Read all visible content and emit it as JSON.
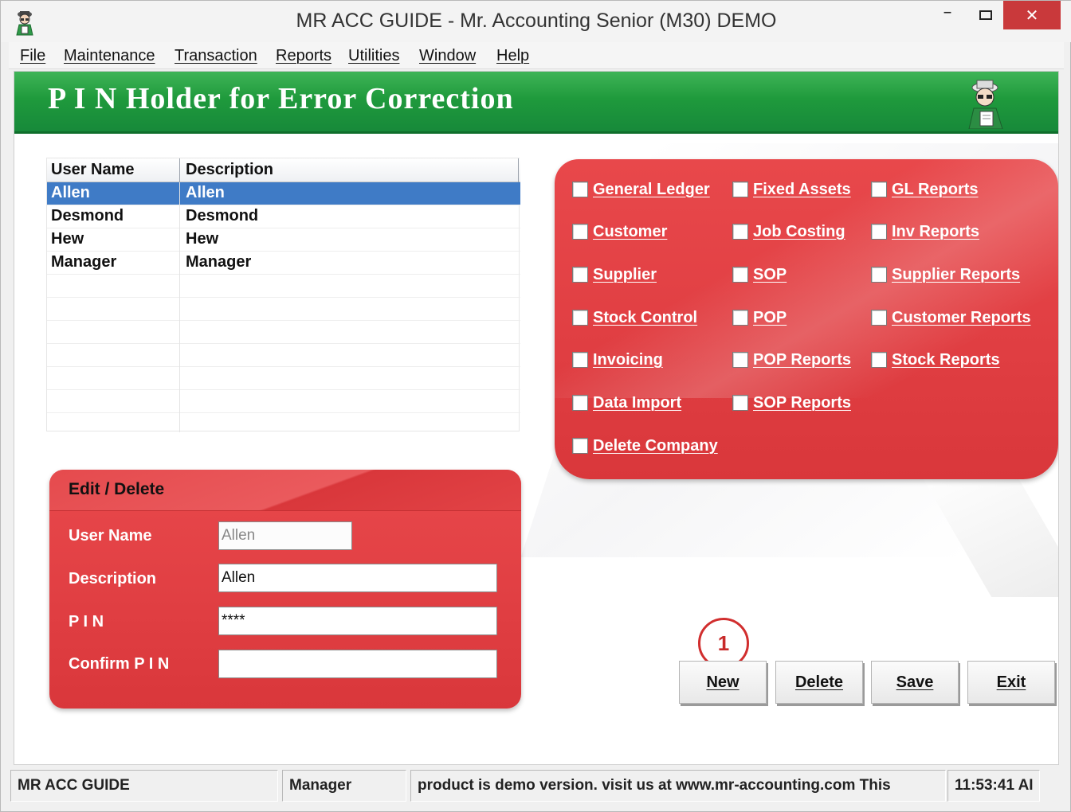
{
  "window": {
    "title": "MR ACC GUIDE - Mr. Accounting Senior (M30) DEMO",
    "close_glyph": "✕",
    "minimize_glyph": "–"
  },
  "menu": {
    "items": [
      {
        "label": "File"
      },
      {
        "label": "Maintenance"
      },
      {
        "label": "Transaction"
      },
      {
        "label": "Reports"
      },
      {
        "label": "Utilities"
      },
      {
        "label": "Window"
      },
      {
        "label": "Help"
      }
    ]
  },
  "banner": {
    "title": "P I N Holder for Error Correction"
  },
  "user_grid": {
    "columns": [
      "User Name",
      "Description"
    ],
    "rows": [
      {
        "user": "Allen",
        "description": "Allen",
        "selected": true
      },
      {
        "user": "Desmond",
        "description": "Desmond",
        "selected": false
      },
      {
        "user": "Hew",
        "description": "Hew",
        "selected": false
      },
      {
        "user": "Manager",
        "description": "Manager",
        "selected": false
      }
    ]
  },
  "modules": {
    "checkboxes": [
      {
        "label": "General Ledger",
        "checked": false
      },
      {
        "label": "Fixed Assets",
        "checked": false
      },
      {
        "label": "GL Reports",
        "checked": false
      },
      {
        "label": "Customer",
        "checked": false
      },
      {
        "label": "Job Costing",
        "checked": false
      },
      {
        "label": "Inv Reports",
        "checked": false
      },
      {
        "label": "Supplier",
        "checked": false
      },
      {
        "label": "SOP",
        "checked": false
      },
      {
        "label": "Supplier Reports",
        "checked": false
      },
      {
        "label": "Stock Control",
        "checked": false
      },
      {
        "label": "POP",
        "checked": false
      },
      {
        "label": "Customer Reports",
        "checked": false
      },
      {
        "label": "Invoicing",
        "checked": false
      },
      {
        "label": "POP Reports",
        "checked": false
      },
      {
        "label": "Stock Reports",
        "checked": false
      },
      {
        "label": "Data Import",
        "checked": false
      },
      {
        "label": "SOP Reports",
        "checked": false
      },
      {
        "label": "Delete Company",
        "checked": false
      }
    ]
  },
  "edit_panel": {
    "title": "Edit / Delete",
    "user_name_label": "User Name",
    "user_name_value": "Allen",
    "description_label": "Description",
    "description_value": "Allen",
    "pin_label": "P I N",
    "pin_value": "****",
    "confirm_pin_label": "Confirm P I N",
    "confirm_pin_value": ""
  },
  "buttons": {
    "new": "New",
    "delete": "Delete",
    "save": "Save",
    "exit": "Exit"
  },
  "callout": {
    "number": "1"
  },
  "status_bar": {
    "app": "MR ACC GUIDE",
    "user": "Manager",
    "message": "product is demo version.  visit us at www.mr-accounting.com This",
    "time": "11:53:41 AI"
  },
  "colors": {
    "banner_green": "#1f9a3c",
    "panel_red": "#e03e42",
    "selection_blue": "#3f7bc6",
    "close_red": "#c9393b"
  }
}
